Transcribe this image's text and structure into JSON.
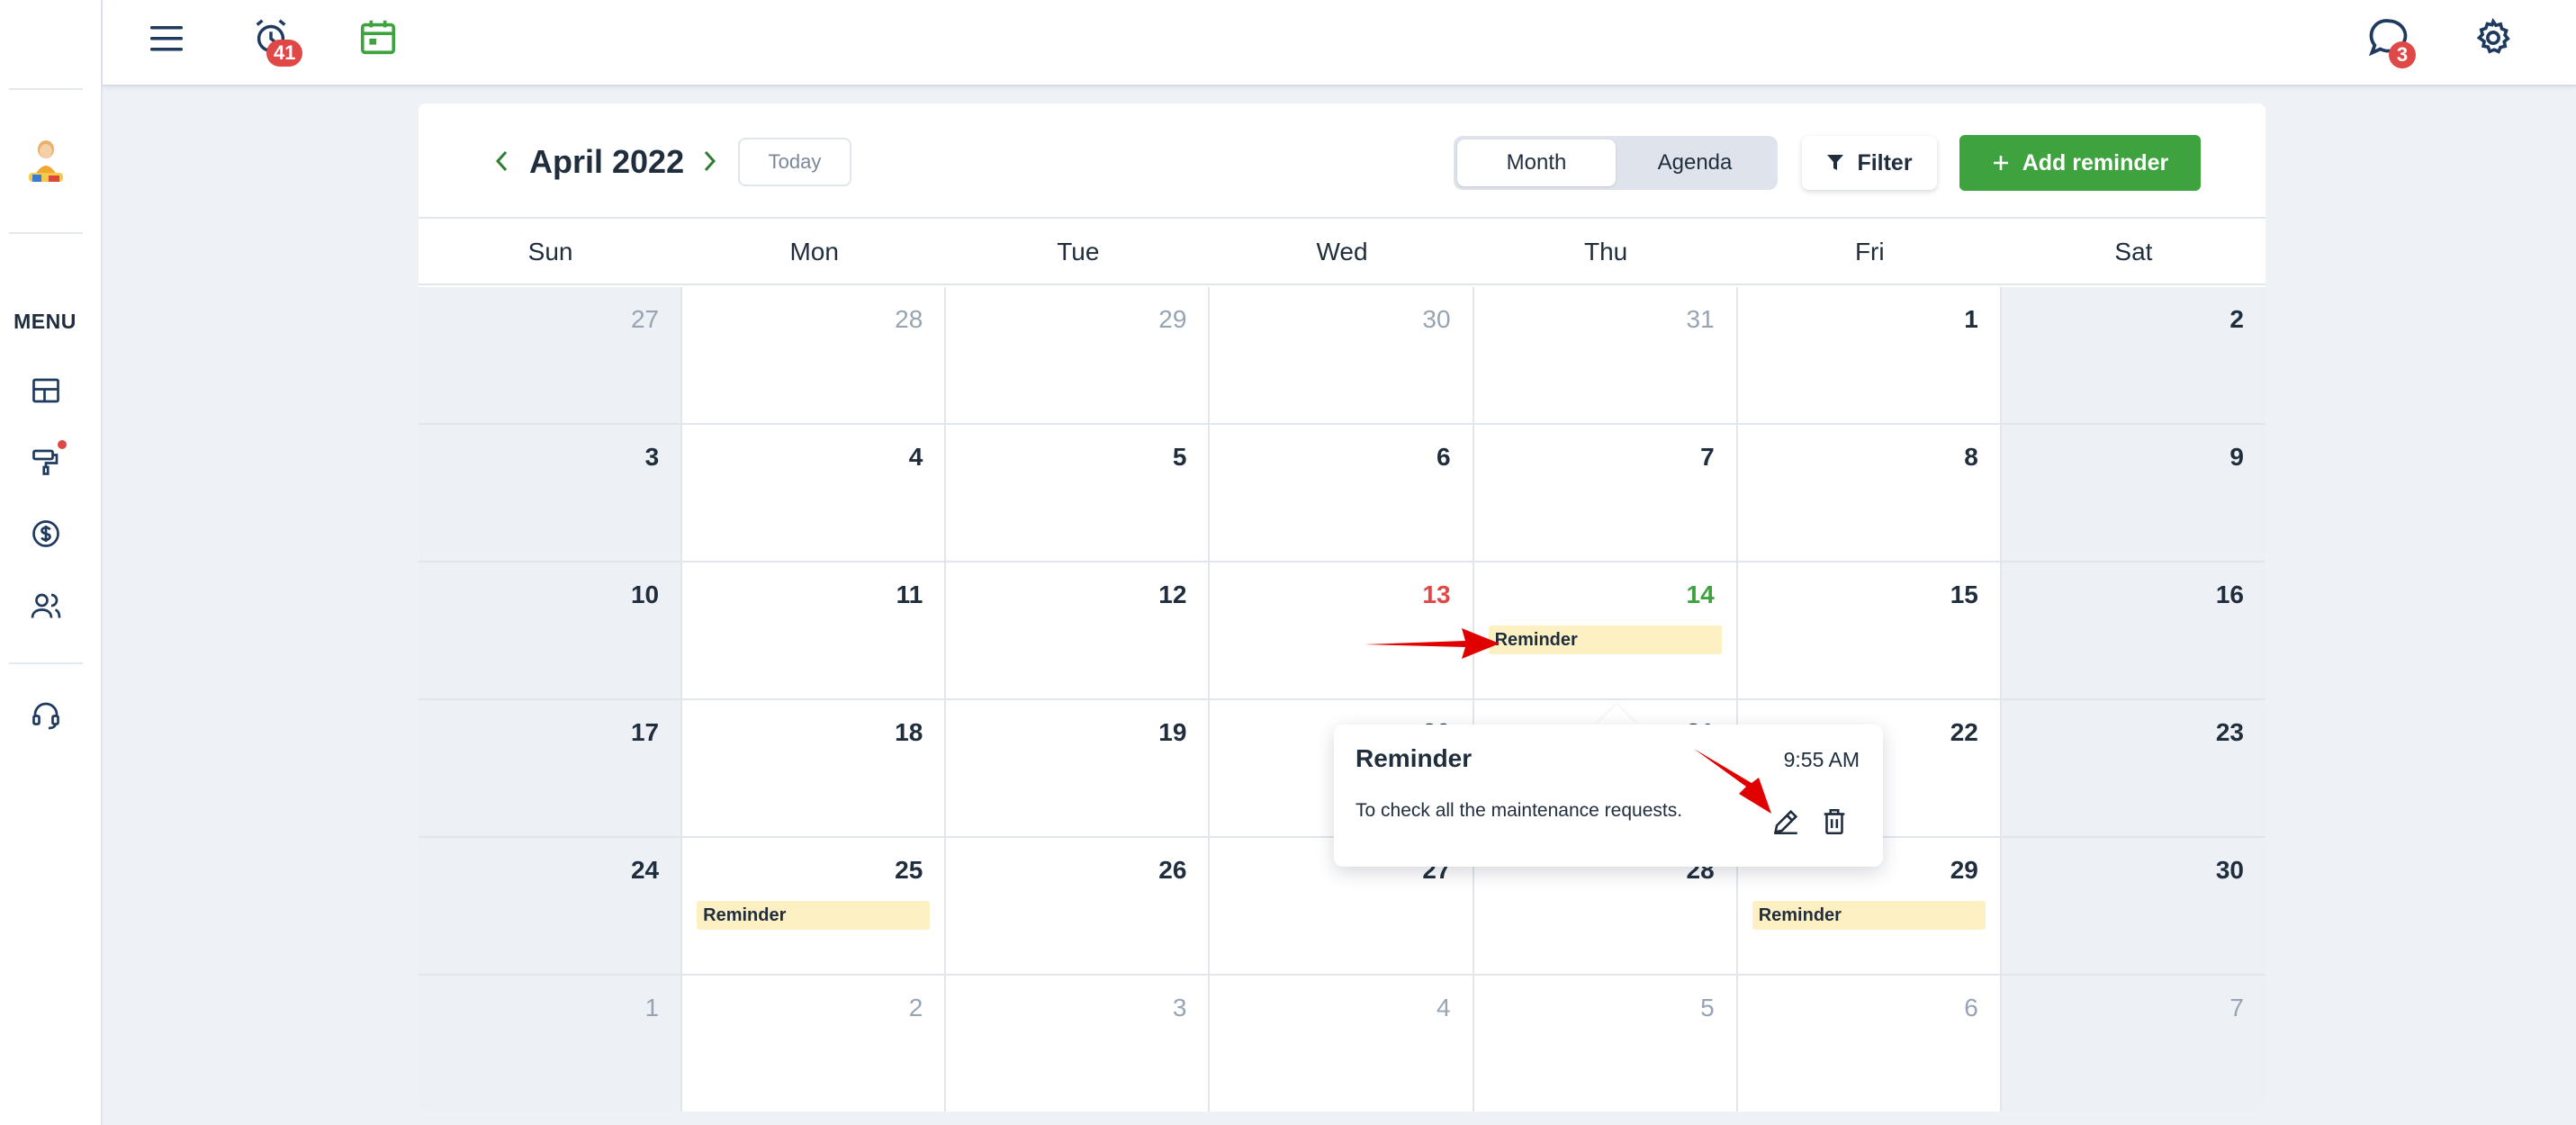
{
  "topbar": {
    "alarm_badge": "41",
    "chat_badge": "3"
  },
  "sidebar": {
    "menu_label": "MENU",
    "items": [
      {
        "icon": "dashboard-icon"
      },
      {
        "icon": "maintenance-icon"
      },
      {
        "icon": "dollar-icon"
      },
      {
        "icon": "users-icon"
      },
      {
        "icon": "headset-icon"
      }
    ]
  },
  "calendar": {
    "month_title": "April 2022",
    "today_label": "Today",
    "view_month": "Month",
    "view_agenda": "Agenda",
    "filter_label": "Filter",
    "add_label": "Add reminder",
    "weekdays": [
      "Sun",
      "Mon",
      "Tue",
      "Wed",
      "Thu",
      "Fri",
      "Sat"
    ],
    "weeks": [
      [
        "27",
        "28",
        "29",
        "30",
        "31",
        "1",
        "2"
      ],
      [
        "3",
        "4",
        "5",
        "6",
        "7",
        "8",
        "9"
      ],
      [
        "10",
        "11",
        "12",
        "13",
        "14",
        "15",
        "16"
      ],
      [
        "17",
        "18",
        "19",
        "20",
        "21",
        "22",
        "23"
      ],
      [
        "24",
        "25",
        "26",
        "27",
        "28",
        "29",
        "30"
      ],
      [
        "1",
        "2",
        "3",
        "4",
        "5",
        "6",
        "7"
      ]
    ],
    "events": [
      {
        "week": 2,
        "day": 4,
        "label": "Reminder"
      },
      {
        "week": 4,
        "day": 1,
        "label": "Reminder"
      },
      {
        "week": 4,
        "day": 5,
        "label": "Reminder"
      }
    ]
  },
  "popover": {
    "title": "Reminder",
    "time": "9:55 AM",
    "description": "To check all the maintenance requests."
  },
  "colors": {
    "accent_green": "#3ea33e",
    "badge_red": "#e04848",
    "event_yellow": "#fdf1c4",
    "annotation_red": "#e00000"
  }
}
